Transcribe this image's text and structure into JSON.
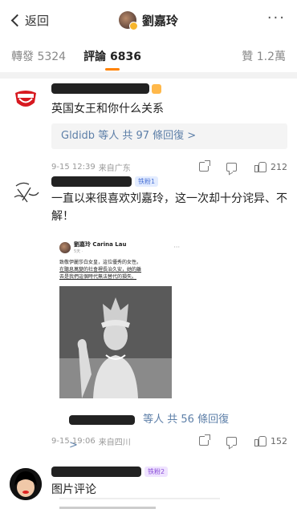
{
  "nav": {
    "back_label": "返回",
    "title": "劉嘉玲",
    "more": "···"
  },
  "tabs": {
    "repost": "轉發 5324",
    "comments": "評論 6836",
    "likes": "贊 1.2萬"
  },
  "comments": [
    {
      "text": "英国女王和你什么关系",
      "reply_user": "Gldidb",
      "reply_summary": "等人 共 97 條回復 >",
      "time": "9-15 12:39",
      "location": "来自广东",
      "likes": "212"
    },
    {
      "badge": "铁粉1",
      "text": "一直以来很喜欢刘嘉玲，这一次却十分诧异、不解！",
      "embed": {
        "name": "劉嘉玲 Carina Lau",
        "sub": "5天 ·",
        "line1": "致敬伊麗莎白女皇，這位優秀的女性。",
        "line2": "在聽息萬變的社會裡長治久安，她的離",
        "line3": "去是我們這個時代無法替代的損失。"
      },
      "reply_summary": "等人 共 56 條回復 >",
      "time": "9-15 19:06",
      "location": "来自四川",
      "likes": "152"
    },
    {
      "badge": "铁粉2",
      "text": "图片评论"
    }
  ]
}
